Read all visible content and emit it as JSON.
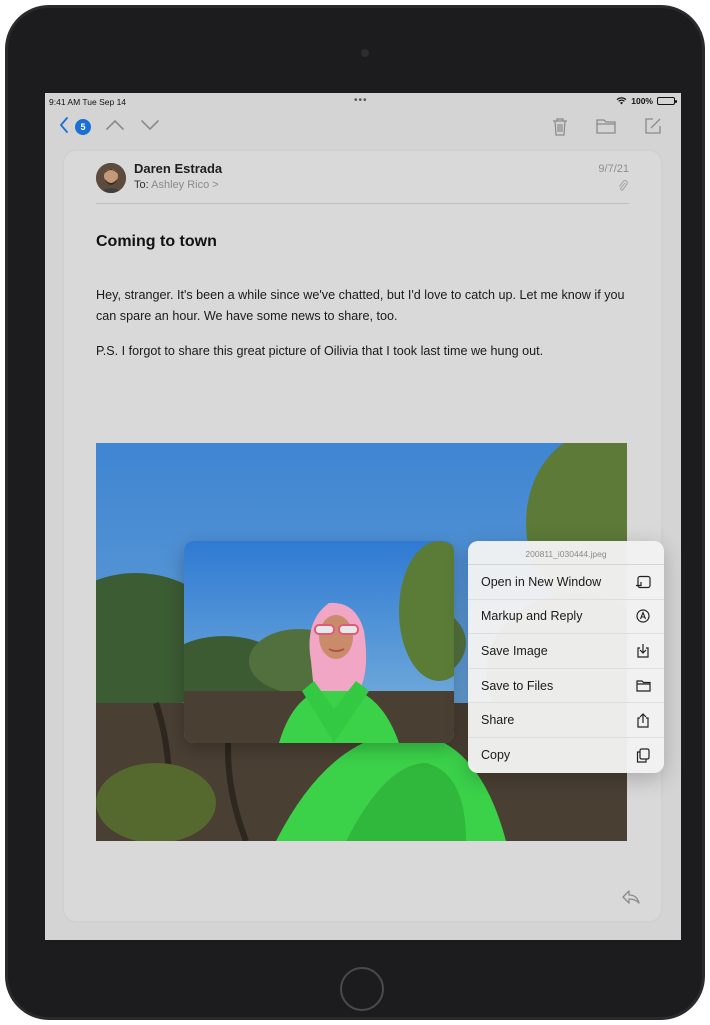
{
  "status_bar": {
    "time": "9:41 AM  Tue Sep 14",
    "dots": "•••",
    "battery": "100%",
    "battery_level": 1.0
  },
  "toolbar": {
    "unread_count": "5"
  },
  "message": {
    "sender": "Daren Estrada",
    "to_label": "To:",
    "to_name": "Ashley Rico >",
    "date": "9/7/21",
    "subject": "Coming to town",
    "paragraphs": [
      "Hey, stranger. It's been a while since we've chatted, but I'd love to catch up. Let me know if you can spare an hour. We have some news to share, too.",
      "P.S. I forgot to share this great picture of Oilivia that I took last time we hung out."
    ]
  },
  "context_menu": {
    "filename": "200811_i030444.jpeg",
    "items": [
      {
        "label": "Open in New Window",
        "icon": "new-window-icon"
      },
      {
        "label": "Markup and Reply",
        "icon": "markup-icon"
      },
      {
        "label": "Save Image",
        "icon": "save-image-icon"
      },
      {
        "label": "Save to Files",
        "icon": "folder-icon"
      },
      {
        "label": "Share",
        "icon": "share-icon"
      },
      {
        "label": "Copy",
        "icon": "copy-icon"
      }
    ]
  },
  "colors": {
    "accent": "#1a6fd4",
    "screen_dim": "#d4d4d4",
    "bezel": "#1c1c1e"
  }
}
